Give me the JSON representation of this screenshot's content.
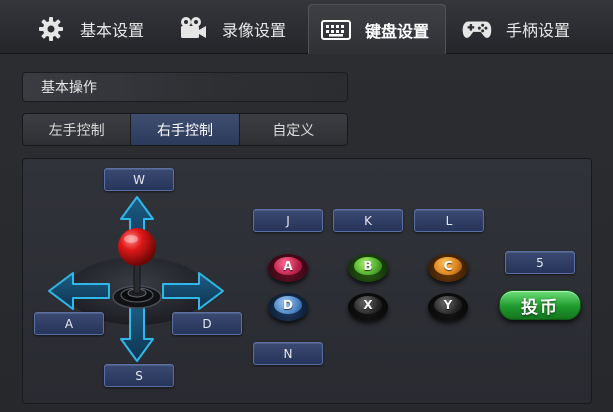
{
  "tabs": [
    {
      "label": "基本设置",
      "icon": "gear-icon"
    },
    {
      "label": "录像设置",
      "icon": "video-camera-icon"
    },
    {
      "label": "键盘设置",
      "icon": "keyboard-icon",
      "active": true
    },
    {
      "label": "手柄设置",
      "icon": "gamepad-icon"
    }
  ],
  "section": {
    "title": "基本操作"
  },
  "subtabs": [
    {
      "label": "左手控制"
    },
    {
      "label": "右手控制",
      "active": true
    },
    {
      "label": "自定义"
    }
  ],
  "joystick": {
    "up_key": "W",
    "left_key": "A",
    "right_key": "D",
    "down_key": "S"
  },
  "action_keys": {
    "j_key": "J",
    "k_key": "K",
    "l_key": "L",
    "n_key": "N",
    "coin_key": "5"
  },
  "buttons": {
    "a": "A",
    "b": "B",
    "c": "C",
    "d": "D",
    "x": "X",
    "y": "Y"
  },
  "coin_button": {
    "label": "投币"
  },
  "colors": {
    "accent": "#3f4d70",
    "button_a": "#c0244f",
    "button_b": "#4fae2b",
    "button_c": "#d9821c",
    "button_d": "#4f86c4",
    "button_x": "#2a2a2a",
    "button_y": "#2a2a2a",
    "coin": "#1f9a2c"
  }
}
